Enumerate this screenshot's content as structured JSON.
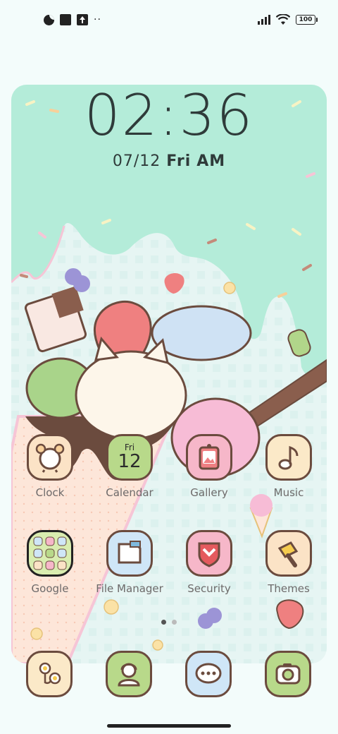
{
  "status_bar": {
    "left_icons": [
      "data-saver-icon",
      "stop-icon",
      "upload-icon",
      "more-dots-icon"
    ],
    "more_dots": "··",
    "right_icons": [
      "signal-icon",
      "wifi-icon",
      "battery-icon"
    ],
    "battery_level": "100"
  },
  "lock_clock": {
    "time": "02:36",
    "date": "07/12",
    "weekday": "Fri",
    "ampm": "AM"
  },
  "apps": [
    {
      "label": "Clock",
      "icon": "alarm-clock-icon",
      "color": "#fbe3c6"
    },
    {
      "label": "Calendar",
      "icon": "calendar-icon",
      "color": "#b8d98a",
      "calendar_day": "Fri",
      "calendar_date": "12"
    },
    {
      "label": "Gallery",
      "icon": "picture-frame-icon",
      "color": "#f6b7c9"
    },
    {
      "label": "Music",
      "icon": "music-note-icon",
      "color": "#fbe9c8"
    },
    {
      "label": "Google",
      "icon": "google-folder-icon",
      "color": "#d9edb0"
    },
    {
      "label": "File Manager",
      "icon": "folder-icon",
      "color": "#cfe6f7"
    },
    {
      "label": "Security",
      "icon": "shield-icon",
      "color": "#f6b7c9"
    },
    {
      "label": "Themes",
      "icon": "paint-brush-icon",
      "color": "#fbe3c6"
    }
  ],
  "page_indicator": {
    "pages": 2,
    "current": 1
  },
  "dock": [
    {
      "icon": "flower-browser-icon",
      "color": "#fbe9c8"
    },
    {
      "icon": "phone-contact-icon",
      "color": "#b8d98a"
    },
    {
      "icon": "message-bubble-icon",
      "color": "#cfe6f7"
    },
    {
      "icon": "camera-icon",
      "color": "#b8d98a"
    }
  ],
  "colors": {
    "mint": "#b4ecd9",
    "cone": "#fbe0cf",
    "chocolate": "#6b4b3e",
    "text": "#2f3b3a"
  }
}
